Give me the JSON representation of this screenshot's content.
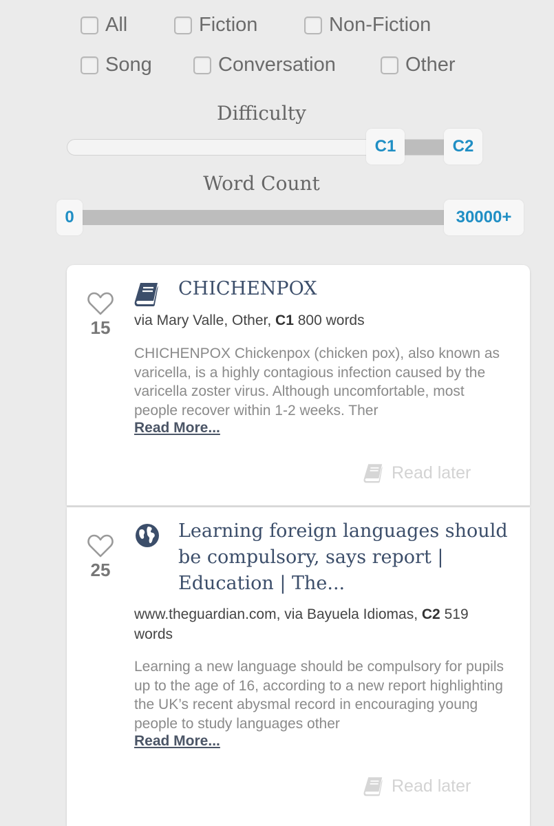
{
  "filters": {
    "types": [
      {
        "label": "All",
        "checked": false
      },
      {
        "label": "Fiction",
        "checked": false
      },
      {
        "label": "Non-Fiction",
        "checked": false
      },
      {
        "label": "Song",
        "checked": false
      },
      {
        "label": "Conversation",
        "checked": false
      },
      {
        "label": "Other",
        "checked": false
      }
    ],
    "difficulty": {
      "label": "Difficulty",
      "min": "C1",
      "max": "C2"
    },
    "word_count": {
      "label": "Word Count",
      "min": "0",
      "max": "30000+"
    }
  },
  "articles": [
    {
      "icon": "book-icon",
      "likes": "15",
      "title": "CHICHENPOX",
      "source": "via Mary Valle, Other, ",
      "level": "C1",
      "words": " 800 words",
      "excerpt": "CHICHENPOX Chickenpox (chicken pox), also known as varicella, is a highly contagious infection caused by the varicella zoster virus. Although uncomfortable, most people recover within 1-2 weeks. Ther",
      "read_more": "Read More...",
      "read_later": "Read later"
    },
    {
      "icon": "globe-icon",
      "likes": "25",
      "title": "Learning foreign languages should be compulsory, says report | Education | The...",
      "source": "www.theguardian.com, via Bayuela Idiomas, ",
      "level": "C2",
      "words": " 519 words",
      "excerpt": "Learning a new language should be compulsory for pupils up to the age of 16, according to a new report highlighting the UK’s recent abysmal record in encouraging young people to study languages other",
      "read_more": "Read More...",
      "read_later": "Read later"
    }
  ],
  "colors": {
    "accent": "#1f8ec4",
    "title": "#3c4e6a",
    "background": "#ebebeb"
  }
}
